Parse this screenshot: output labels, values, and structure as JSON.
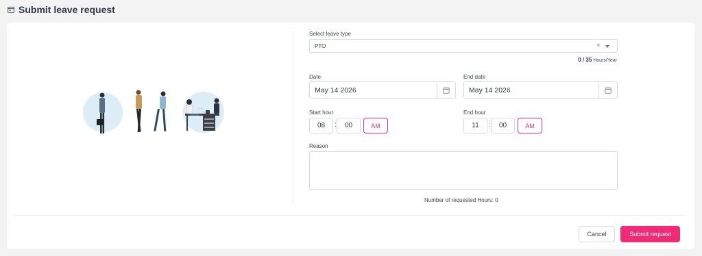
{
  "header": {
    "title": "Submit leave request",
    "icon": "calendar-icon"
  },
  "leave_type": {
    "label": "Select leave type",
    "value": "PTO",
    "clear_glyph": "×"
  },
  "quota": {
    "used": "0",
    "separator": " / ",
    "total": "35",
    "unit": "Hours/Year"
  },
  "date": {
    "label": "Date",
    "value": "May 14 2026"
  },
  "end_date": {
    "label": "End date",
    "value": "May 14 2026"
  },
  "start_hour": {
    "label": "Start hour",
    "hour": "08",
    "minute": "00",
    "period": "AM",
    "colon": ":"
  },
  "end_hour": {
    "label": "End hour",
    "hour": "11",
    "minute": "00",
    "period": "AM",
    "colon": ":"
  },
  "reason": {
    "label": "Reason",
    "value": ""
  },
  "requested_hours": {
    "text": "Number of requested Hours: 0"
  },
  "actions": {
    "cancel": "Cancel",
    "submit": "Submit request"
  },
  "colors": {
    "accent": "#f22b76",
    "accent_text": "#e8336f",
    "border": "#d6d9de",
    "background": "#f3f3f4"
  }
}
